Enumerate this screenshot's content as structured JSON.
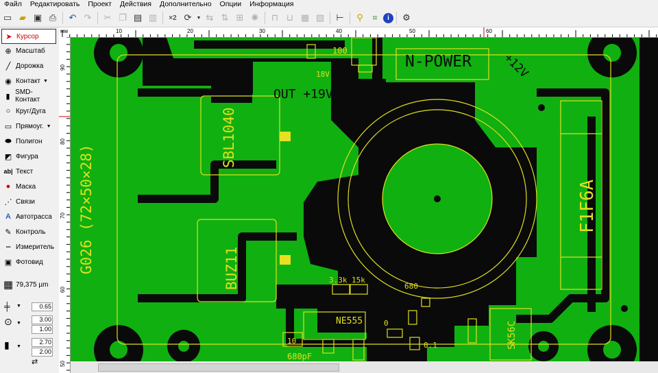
{
  "menu": [
    "Файл",
    "Редактировать",
    "Проект",
    "Действия",
    "Дополнительно",
    "Опции",
    "Информация"
  ],
  "toolbar": {
    "zoom_x2": "×2"
  },
  "tools": [
    {
      "label": "Курсор",
      "icon": "cursor-icon"
    },
    {
      "label": "Масштаб",
      "icon": "zoom-icon"
    },
    {
      "label": "Дорожка",
      "icon": "track-icon"
    },
    {
      "label": "Контакт",
      "icon": "pad-icon"
    },
    {
      "label": "SMD-Контакт",
      "icon": "smd-pad-icon"
    },
    {
      "label": "Круг/Дуга",
      "icon": "circle-icon"
    },
    {
      "label": "Прямоуг.",
      "icon": "rectangle-icon"
    },
    {
      "label": "Полигон",
      "icon": "polygon-icon"
    },
    {
      "label": "Фигура",
      "icon": "shape-icon"
    },
    {
      "label": "Текст",
      "icon": "text-icon"
    },
    {
      "label": "Маска",
      "icon": "mask-icon"
    },
    {
      "label": "Связи",
      "icon": "connections-icon"
    },
    {
      "label": "Автотрасса",
      "icon": "autoroute-icon"
    },
    {
      "label": "Контроль",
      "icon": "check-icon"
    },
    {
      "label": "Измеритель",
      "icon": "measure-icon"
    },
    {
      "label": "Фотовид",
      "icon": "photoview-icon"
    }
  ],
  "grid_value": "79,375 µm",
  "params": {
    "track_width": "0.65",
    "pad_outer": "3.00",
    "pad_inner": "1.00",
    "smd_w": "2.70",
    "smd_h": "2.00"
  },
  "ruler": {
    "unit": "мм",
    "top": [
      "10",
      "20",
      "30",
      "40",
      "50",
      "60"
    ],
    "left": [
      "90",
      "80",
      "70",
      "60",
      "50"
    ]
  },
  "pcb_labels": {
    "board_name": "G026 (72×50×28)",
    "npower": "N-POWER",
    "plus12v": "+12V",
    "out19": "OUT +19V",
    "sbl": "SBL1040",
    "buz": "BUZ11",
    "fuse": "F1F6A",
    "sk": "SK56C",
    "ne555": "NE555",
    "r100": "100",
    "v18": "18V",
    "r33k": "3.3k",
    "r15k": "15k",
    "r680": "680",
    "c680pf": "680pF",
    "r10": "10",
    "r0": "0",
    "r01": "0.1"
  },
  "colors": {
    "board": "#0a0a0a",
    "copper": "#10b010",
    "silk": "#e0e020",
    "active_tool": "#d00000"
  }
}
